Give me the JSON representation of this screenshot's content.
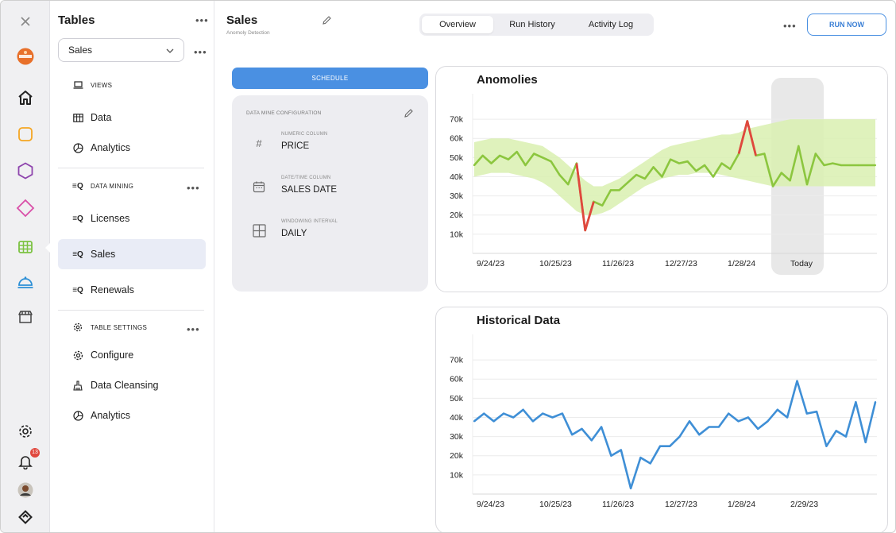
{
  "sidebar_rail": {
    "notif_count": "13",
    "accent_colors": {
      "square": "#f5a623",
      "hexagon": "#8e44ad",
      "diamond": "#d94fa8",
      "grid": "#7cc242",
      "bell": "#2c8fd6"
    }
  },
  "panel": {
    "title": "Tables",
    "table_select": {
      "value": "Sales"
    },
    "views_header": "VIEWS",
    "views_items": [
      {
        "label": "Data",
        "icon": "table-icon"
      },
      {
        "label": "Analytics",
        "icon": "pie-chart-icon"
      }
    ],
    "mining_header": "DATA MINING",
    "mining_items": [
      {
        "label": "Licenses",
        "icon": "data-mine-icon"
      },
      {
        "label": "Sales",
        "icon": "data-mine-icon",
        "active": true
      },
      {
        "label": "Renewals",
        "icon": "data-mine-icon"
      }
    ],
    "settings_header": "TABLE SETTINGS",
    "settings_items": [
      {
        "label": "Configure",
        "icon": "gear-icon"
      },
      {
        "label": "Data Cleansing",
        "icon": "cleansing-icon"
      },
      {
        "label": "Analytics",
        "icon": "pie-chart-icon"
      }
    ]
  },
  "header": {
    "title": "Sales",
    "subtitle": "Anomoly Detection",
    "tabs": [
      "Overview",
      "Run History",
      "Activity Log"
    ],
    "active_tab": "Overview",
    "run_now": "RUN NOW"
  },
  "config": {
    "schedule_label": "SCHEDULE",
    "heading": "DATA MINE CONFIGURATION",
    "fields": [
      {
        "label": "NUMERIC COLUMN",
        "value": "PRICE",
        "icon": "hash-icon"
      },
      {
        "label": "DATE/TIME COLUMN",
        "value": "SALES DATE",
        "icon": "calendar-icon"
      },
      {
        "label": "WINDOWING INTERVAL",
        "value": "DAILY",
        "icon": "grid-icon"
      }
    ]
  },
  "chart_data": [
    {
      "type": "line",
      "title": "Anomolies",
      "ylim": [
        0,
        75000
      ],
      "yticks": [
        "70k",
        "60k",
        "50k",
        "40k",
        "30k",
        "20k",
        "10k"
      ],
      "ytick_values": [
        70000,
        60000,
        50000,
        40000,
        30000,
        20000,
        10000
      ],
      "xtick_labels": [
        "9/24/23",
        "10/25/23",
        "11/26/23",
        "12/27/23",
        "1/28/24",
        "Today"
      ],
      "grid": true,
      "colors": {
        "line": "#8cc63f",
        "band": "#d9f0b0",
        "anomaly": "#e0483e",
        "highlight": "#e8e8e8"
      },
      "series": [
        {
          "x": [
            0,
            1,
            2,
            3,
            4,
            5,
            6,
            7,
            8,
            9,
            10,
            11,
            12,
            13,
            14,
            15,
            16,
            17,
            18,
            19,
            20,
            21,
            22,
            23,
            24,
            25,
            26,
            27,
            28,
            29,
            30,
            31,
            32,
            33,
            34,
            35,
            36,
            37,
            38,
            39,
            40,
            41,
            42,
            43,
            44,
            45,
            46,
            47
          ],
          "values": [
            46000,
            51000,
            47000,
            51000,
            49000,
            53000,
            46000,
            52000,
            50000,
            48000,
            41000,
            36000,
            47000,
            12000,
            27000,
            25000,
            33000,
            33000,
            37000,
            41000,
            39000,
            45000,
            40000,
            49000,
            47000,
            48000,
            43000,
            46000,
            40000,
            47000,
            44000,
            52000,
            69000,
            51000,
            52000,
            35000,
            42000,
            38000,
            56000,
            36000,
            52000,
            46000,
            47000,
            46000,
            46000,
            46000,
            46000,
            46000
          ]
        }
      ],
      "band": {
        "upper": [
          58000,
          59000,
          60000,
          60000,
          60000,
          59000,
          58000,
          57000,
          56000,
          53000,
          50000,
          46000,
          42000,
          38000,
          35000,
          35000,
          37000,
          39000,
          42000,
          45000,
          48000,
          51000,
          54000,
          56000,
          57000,
          58000,
          59000,
          60000,
          61000,
          62000,
          62000,
          63000,
          65000,
          66000,
          67000,
          68000,
          69000,
          70000,
          70000,
          70000,
          70000,
          70000,
          70000,
          70000,
          70000,
          70000,
          70000,
          70000
        ],
        "lower": [
          40000,
          41000,
          42000,
          42000,
          42000,
          41000,
          40000,
          39000,
          37000,
          34000,
          30000,
          26000,
          22000,
          20000,
          20000,
          21000,
          23000,
          26000,
          29000,
          32000,
          35000,
          37000,
          39000,
          40000,
          41000,
          41000,
          42000,
          42000,
          42000,
          41000,
          40000,
          39000,
          38000,
          37000,
          36000,
          35000,
          35000,
          35000,
          35000,
          35000,
          35000,
          35000,
          35000,
          35000,
          35000,
          35000,
          35000,
          35000
        ]
      },
      "anomalies": [
        {
          "from": 12,
          "to": 14
        },
        {
          "from": 31,
          "to": 33
        }
      ],
      "highlight_label": "Today"
    },
    {
      "type": "line",
      "title": "Historical Data",
      "ylim": [
        0,
        75000
      ],
      "yticks": [
        "70k",
        "60k",
        "50k",
        "40k",
        "30k",
        "20k",
        "10k"
      ],
      "ytick_values": [
        70000,
        60000,
        50000,
        40000,
        30000,
        20000,
        10000
      ],
      "xtick_labels": [
        "9/24/23",
        "10/25/23",
        "11/26/23",
        "12/27/23",
        "1/28/24",
        "2/29/23"
      ],
      "grid": true,
      "colors": {
        "line": "#3f8fd6"
      },
      "series": [
        {
          "x": [
            0,
            1,
            2,
            3,
            4,
            5,
            6,
            7,
            8,
            9,
            10,
            11,
            12,
            13,
            14,
            15,
            16,
            17,
            18,
            19,
            20,
            21,
            22,
            23,
            24,
            25,
            26,
            27,
            28,
            29,
            30,
            31,
            32,
            33,
            34,
            35,
            36,
            37,
            38,
            39,
            40,
            41
          ],
          "values": [
            38000,
            42000,
            38000,
            42000,
            40000,
            44000,
            38000,
            42000,
            40000,
            42000,
            31000,
            34000,
            28000,
            35000,
            20000,
            23000,
            3000,
            19000,
            16000,
            25000,
            25000,
            30000,
            38000,
            31000,
            35000,
            35000,
            42000,
            38000,
            40000,
            34000,
            38000,
            44000,
            40000,
            59000,
            42000,
            43000,
            25000,
            33000,
            30000,
            48000,
            27000,
            48000
          ]
        }
      ]
    }
  ]
}
